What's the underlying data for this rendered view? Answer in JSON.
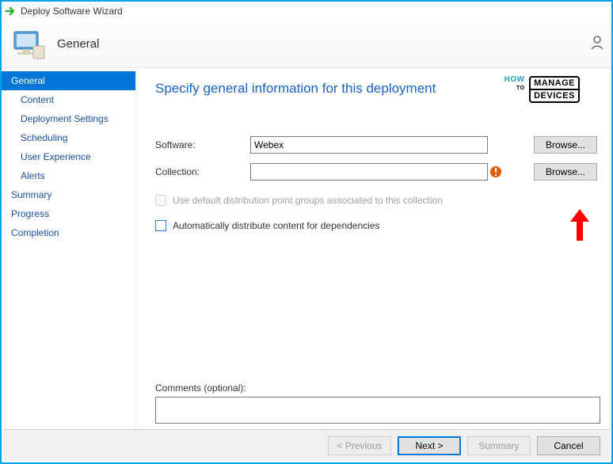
{
  "window": {
    "title": "Deploy Software Wizard"
  },
  "header": {
    "page_title": "General"
  },
  "sidebar": {
    "items": [
      {
        "label": "General",
        "indent": false,
        "selected": true
      },
      {
        "label": "Content",
        "indent": true,
        "selected": false
      },
      {
        "label": "Deployment Settings",
        "indent": true,
        "selected": false
      },
      {
        "label": "Scheduling",
        "indent": true,
        "selected": false
      },
      {
        "label": "User Experience",
        "indent": true,
        "selected": false
      },
      {
        "label": "Alerts",
        "indent": true,
        "selected": false
      },
      {
        "label": "Summary",
        "indent": false,
        "selected": false
      },
      {
        "label": "Progress",
        "indent": false,
        "selected": false
      },
      {
        "label": "Completion",
        "indent": false,
        "selected": false
      }
    ]
  },
  "content": {
    "heading": "Specify general information for this deployment",
    "software_label": "Software:",
    "software_value": "Webex",
    "collection_label": "Collection:",
    "collection_value": "",
    "browse_label": "Browse...",
    "use_default_label": "Use default distribution point groups associated to this collection",
    "auto_distribute_label": "Automatically distribute content for dependencies",
    "comments_label": "Comments (optional):",
    "comments_value": ""
  },
  "logo": {
    "how": "HOW",
    "to": "TO",
    "line1": "MANAGE",
    "line2": "DEVICES"
  },
  "footer": {
    "previous": "< Previous",
    "next": "Next >",
    "summary": "Summary",
    "cancel": "Cancel"
  }
}
